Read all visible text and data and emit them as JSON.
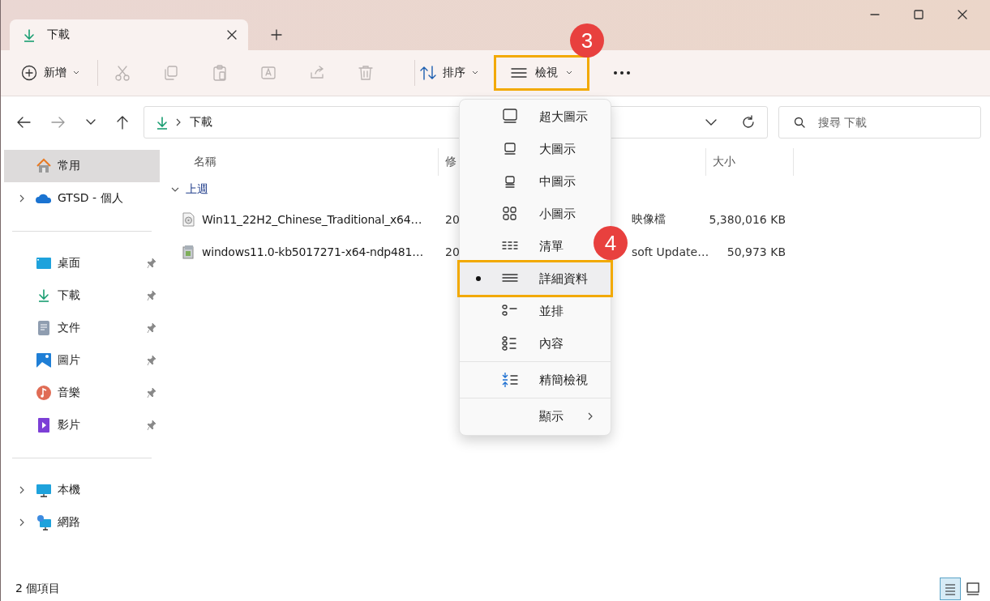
{
  "tabs": [
    {
      "label": "下載",
      "selected": true
    }
  ],
  "toolbar": {
    "new_label": "新增",
    "actions": [
      {
        "disabled": true
      },
      {
        "disabled": true
      },
      {
        "disabled": true
      },
      {
        "disabled": true
      },
      {
        "disabled": true
      },
      {
        "disabled": true
      }
    ],
    "sort_label": "排序",
    "view_label": "檢視"
  },
  "address": {
    "crumb": "下載",
    "search_placeholder": "搜尋 下載"
  },
  "sidebar": {
    "groups": [
      [
        {
          "label": "常用",
          "kind": "plain",
          "selected": true
        },
        {
          "label": "GTSD - 個人",
          "kind": "tree",
          "selected": false
        }
      ],
      [
        {
          "label": "桌面",
          "kind": "pinned",
          "selected": false
        },
        {
          "label": "下載",
          "kind": "pinned",
          "selected": false
        },
        {
          "label": "文件",
          "kind": "pinned",
          "selected": false
        },
        {
          "label": "圖片",
          "kind": "pinned",
          "selected": false
        },
        {
          "label": "音樂",
          "kind": "pinned",
          "selected": false
        },
        {
          "label": "影片",
          "kind": "pinned",
          "selected": false
        }
      ],
      [
        {
          "label": "本機",
          "kind": "tree",
          "selected": false
        },
        {
          "label": "網路",
          "kind": "tree",
          "selected": false
        }
      ]
    ]
  },
  "table": {
    "columns": [
      "名稱",
      "修",
      "",
      "大小"
    ],
    "groups": [
      {
        "label": "上週",
        "expanded": true,
        "rows": [
          {
            "name": "Win11_22H2_Chinese_Traditional_x64…",
            "column_2": "20",
            "column_3": "映像檔",
            "size": "5,380,016 KB"
          },
          {
            "name": "windows11.0-kb5017271-x64-ndp481…",
            "column_2": "20",
            "column_3": "soft Update…",
            "size": "50,973 KB"
          }
        ]
      }
    ]
  },
  "view_menu": {
    "sections": [
      [
        {
          "label": "超大圖示",
          "kind": "view",
          "selected": false
        },
        {
          "label": "大圖示",
          "kind": "view",
          "selected": false
        },
        {
          "label": "中圖示",
          "kind": "view",
          "selected": false
        },
        {
          "label": "小圖示",
          "kind": "view",
          "selected": false
        },
        {
          "label": "清單",
          "kind": "view",
          "selected": false
        },
        {
          "label": "詳細資料",
          "kind": "view",
          "selected": true
        },
        {
          "label": "並排",
          "kind": "view",
          "selected": false
        },
        {
          "label": "內容",
          "kind": "view",
          "selected": false
        }
      ],
      [
        {
          "label": "精簡檢視",
          "kind": "view",
          "selected": false
        }
      ],
      [
        {
          "label": "顯示",
          "kind": "submenu",
          "selected": false
        }
      ]
    ]
  },
  "annotations": [
    {
      "label": "3"
    },
    {
      "label": "4"
    }
  ],
  "status_bar": {
    "count": "2 個項目",
    "view_toggles": [
      {
        "selected": true
      },
      {
        "selected": false
      }
    ]
  }
}
